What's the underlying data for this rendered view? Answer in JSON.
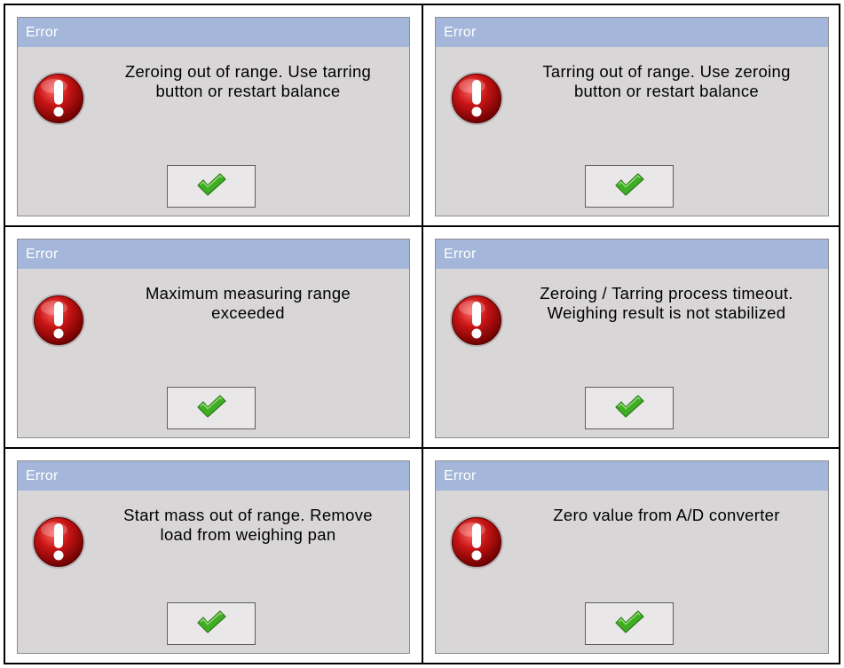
{
  "dialogs": [
    {
      "title": "Error",
      "message": "Zeroing out of range. Use tarring\nbutton or restart balance"
    },
    {
      "title": "Error",
      "message": "Tarring out of range. Use zeroing\nbutton or restart balance"
    },
    {
      "title": "Error",
      "message": "Maximum measuring range\nexceeded"
    },
    {
      "title": "Error",
      "message": "Zeroing / Tarring process timeout.\nWeighing result is not stabilized"
    },
    {
      "title": "Error",
      "message": "Start mass out of range. Remove\nload from weighing pan"
    },
    {
      "title": "Error",
      "message": "Zero value from A/D converter"
    }
  ],
  "icons": {
    "error": "exclamation-error-icon",
    "confirm": "green-checkmark-icon"
  },
  "colors": {
    "titlebar": "#a4b7da",
    "dialog_bg": "#d9d6d8",
    "error_red": "#c81414",
    "check_green": "#3fae24"
  }
}
